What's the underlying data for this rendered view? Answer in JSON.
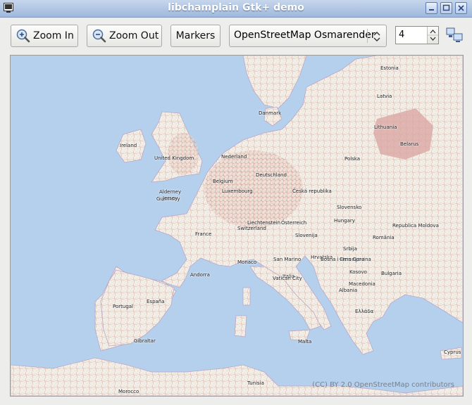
{
  "window": {
    "title": "libchamplain Gtk+ demo",
    "controls": [
      "minimize",
      "maximize",
      "close"
    ]
  },
  "toolbar": {
    "zoom_in_label": "Zoom In",
    "zoom_out_label": "Zoom Out",
    "markers_label": "Markers",
    "map_source_selected": "OpenStreetMap Osmarender",
    "zoom_level": "4"
  },
  "map": {
    "attribution": "(CC) BY 2.0 OpenStreetMap contributors",
    "places": {
      "estonia": "Estonia",
      "latvia": "Latvia",
      "lithuania": "Lithuania",
      "danmark": "Danmark",
      "belarus": "Belarus",
      "ireland": "Ireland",
      "united_kingdom": "United Kingdom",
      "nederland": "Nederland",
      "deutschland": "Deutschland",
      "polska": "Polska",
      "belgium": "Belgium",
      "luxembourg": "Luxembourg",
      "ceska_republika": "Česká republika",
      "alderney": "Alderney",
      "guernsey": "Guernsey",
      "jersey": "Jersey",
      "slovensko": "Slovensko",
      "liechtenstein": "Liechtenstein",
      "osterreich": "Österreich",
      "switzerland": "Switzerland",
      "hungary": "Hungary",
      "republica_moldova": "Republica Moldova",
      "france": "France",
      "slovenija": "Slovenija",
      "romania": "România",
      "hrvatska": "Hrvatska",
      "bosna": "Bosna i Hercegovina",
      "srbija": "Srbija",
      "monaco": "Monaco",
      "san_marino": "San Marino",
      "crna_gora": "Crna Gora",
      "andorra": "Andorra",
      "italia": "Italia",
      "kosovo": "Kosovo",
      "bulgaria": "Bulgaria",
      "vatican": "Vatican City",
      "macedonia": "Macedonia",
      "albania": "Albania",
      "portugal": "Portugal",
      "espana": "España",
      "ellada": "Ελλάδα",
      "gibraltar": "Gibraltar",
      "malta": "Malta",
      "cyprus": "Cyprus",
      "morocco": "Morocco",
      "tunisia": "Tunisia"
    }
  },
  "colors": {
    "sea": "#b5d0ed",
    "land": "#f2efe9",
    "border": "#b9a6c6",
    "roads": "#d68a7a",
    "titlebar": "#a9c0e2"
  }
}
